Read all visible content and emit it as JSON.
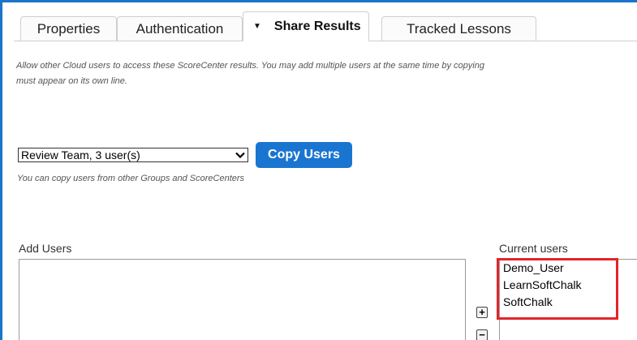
{
  "tabs": [
    {
      "label": "Properties"
    },
    {
      "label": "Authentication"
    },
    {
      "label": "Share Results",
      "active": true
    },
    {
      "label": "Tracked Lessons"
    }
  ],
  "share": {
    "description_line1": "Allow other Cloud users to access these ScoreCenter results. You may add multiple users at the same time by copying",
    "description_line2": "must appear on its own line.",
    "group_select_value": "Review Team, 3 user(s)",
    "copy_button": "Copy Users",
    "copy_hint": "You can copy users from other Groups and ScoreCenters",
    "add_users_label": "Add Users",
    "current_users_label": "Current users",
    "current_users": [
      "Demo_User",
      "LearnSoftChalk",
      "SoftChalk"
    ],
    "add_button": "+",
    "remove_button": "−"
  },
  "colors": {
    "accent": "#1a75d1",
    "frame": "#1c73c9",
    "highlight": "#e3242b"
  }
}
